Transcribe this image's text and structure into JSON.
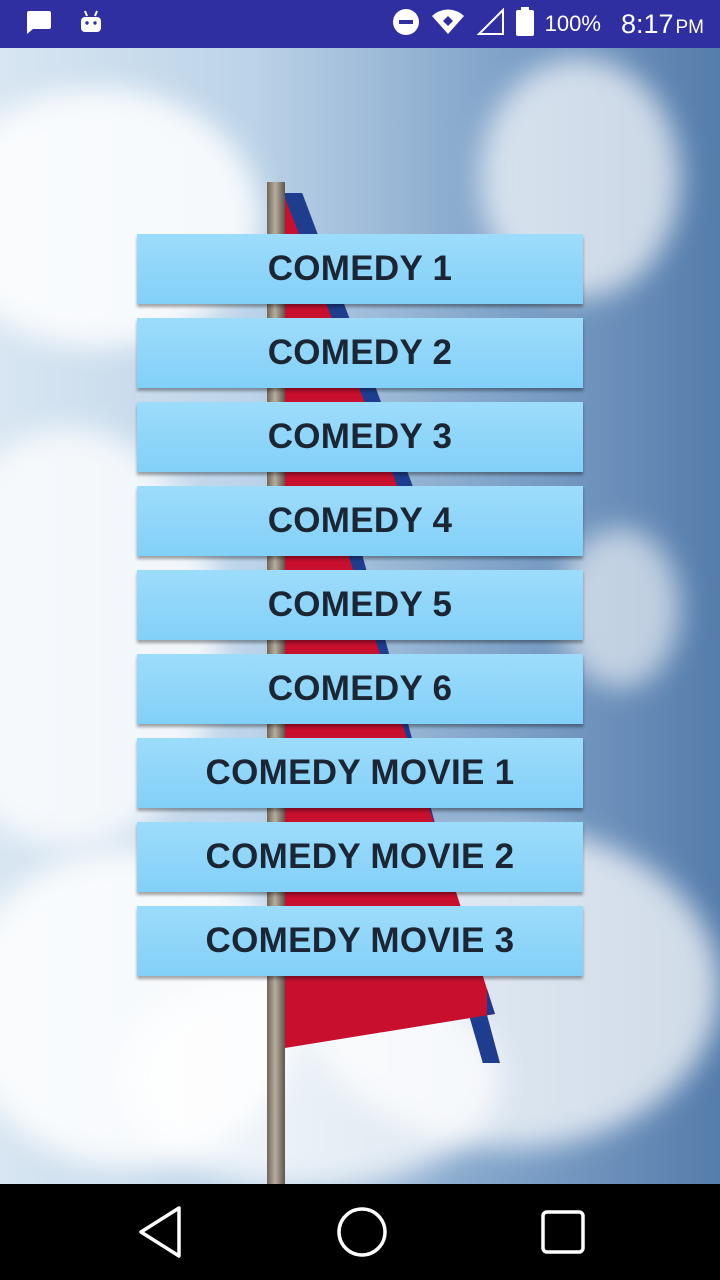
{
  "status_bar": {
    "battery": "100%",
    "time": "8:17",
    "ampm": "PM",
    "icons": [
      "message-icon",
      "android-icon",
      "do-not-disturb-icon",
      "wifi-icon",
      "signal-icon",
      "battery-icon"
    ]
  },
  "menu": {
    "items": [
      {
        "label": "COMEDY 1"
      },
      {
        "label": "COMEDY 2"
      },
      {
        "label": "COMEDY 3"
      },
      {
        "label": "COMEDY 4"
      },
      {
        "label": "COMEDY 5"
      },
      {
        "label": "COMEDY 6"
      },
      {
        "label": "COMEDY MOVIE 1"
      },
      {
        "label": "COMEDY MOVIE 2"
      },
      {
        "label": "COMEDY MOVIE 3"
      }
    ]
  },
  "nav_bar": {
    "icons": [
      "back-icon",
      "home-icon",
      "recents-icon"
    ]
  },
  "colors": {
    "status_bar": "#2f2fa2",
    "button": "#8ed5f9",
    "button_text": "#1c2533"
  }
}
